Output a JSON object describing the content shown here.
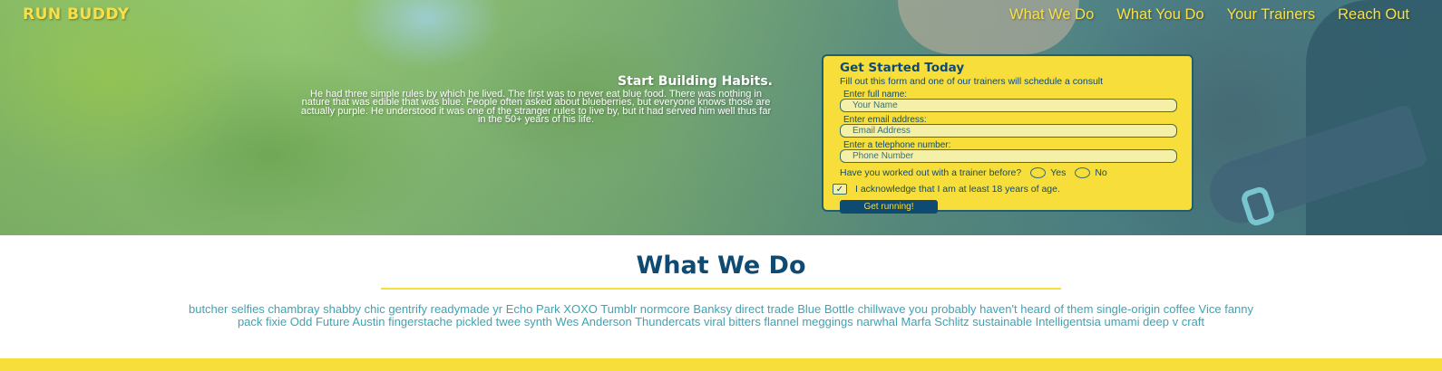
{
  "header": {
    "logo": "RUN BUDDY",
    "nav": [
      "What We Do",
      "What You Do",
      "Your Trainers",
      "Reach Out"
    ]
  },
  "hero": {
    "heading": "Start Building Habits.",
    "body": "He had three simple rules by which he lived. The first was to never eat blue food. There was nothing in nature that was edible that was blue. People often asked about blueberries, but everyone knows those are actually purple. He understood it was one of the stranger rules to live by, but it had served him well thus far in the 50+ years of his life."
  },
  "form": {
    "title": "Get Started Today",
    "intro": "Fill out this form and one of our trainers will schedule a consult",
    "name_label": "Enter full name:",
    "name_placeholder": "Your Name",
    "email_label": "Enter email address:",
    "email_placeholder": "Email Address",
    "phone_label": "Enter a telephone number:",
    "phone_placeholder": "Phone Number",
    "trainer_question": "Have you worked out with a trainer before?",
    "radio_yes": "Yes",
    "radio_no": "No",
    "age_checked": true,
    "age_check_mark": "✓",
    "age_ack": "I acknowledge that I am at least 18 years of age.",
    "submit": "Get running!"
  },
  "what_we_do": {
    "title": "What We Do",
    "body": "butcher selfies chambray shabby chic gentrify readymade yr Echo Park XOXO Tumblr normcore Banksy direct trade Blue Bottle chillwave you probably haven't heard of them single-origin coffee Vice fanny pack fixie Odd Future Austin fingerstache pickled twee synth Wes Anderson Thundercats viral bitters flannel meggings narwhal Marfa Schlitz sustainable Intelligentsia umami deep v craft"
  },
  "colors": {
    "accent_yellow": "#f7de3b",
    "navy": "#0f4a72",
    "teal_text": "#3fa3b3"
  }
}
